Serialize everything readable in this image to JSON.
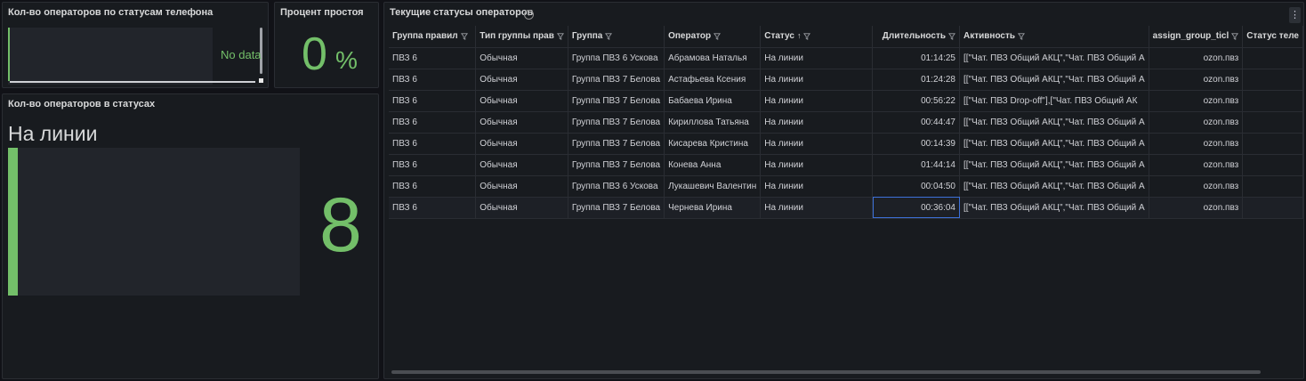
{
  "panel_phone_status": {
    "title": "Кол-во операторов по статусам телефона",
    "no_data": "No data"
  },
  "panel_idle": {
    "title": "Процент простоя",
    "value": "0",
    "unit": "%"
  },
  "panel_status_count": {
    "title": "Кол-во операторов в статусах",
    "label": "На линии",
    "value": "8",
    "bar_level": 1.0
  },
  "panel_table": {
    "title": "Текущие статусы операторов",
    "info_icon": "info-circle-icon",
    "menu_icon": "⋮",
    "columns": [
      "Группа правил",
      "Тип группы прав",
      "Группа",
      "Оператор",
      "Статус",
      "Длительность",
      "Активность",
      "assign_group_ticl",
      "Статус теле"
    ],
    "rows": [
      [
        "ПВЗ 6",
        "Обычная",
        "Группа ПВЗ 6 Ускова",
        "Абрамова Наталья",
        "На линии",
        "01:14:25",
        "[[\"Чат. ПВЗ Общий АКЦ\",\"Чат. ПВЗ Общий А",
        "ozon.пвз",
        ""
      ],
      [
        "ПВЗ 6",
        "Обычная",
        "Группа ПВЗ 7 Белова",
        "Астафьева Ксения",
        "На линии",
        "01:24:28",
        "[[\"Чат. ПВЗ Общий АКЦ\",\"Чат. ПВЗ Общий А",
        "ozon.пвз",
        ""
      ],
      [
        "ПВЗ 6",
        "Обычная",
        "Группа ПВЗ 7 Белова",
        "Бабаева Ирина",
        "На линии",
        "00:56:22",
        "[[\"Чат. ПВЗ Drop-off\"],[\"Чат. ПВЗ Общий АК",
        "ozon.пвз",
        ""
      ],
      [
        "ПВЗ 6",
        "Обычная",
        "Группа ПВЗ 7 Белова",
        "Кириллова Татьяна",
        "На линии",
        "00:44:47",
        "[[\"Чат. ПВЗ Общий АКЦ\",\"Чат. ПВЗ Общий А",
        "ozon.пвз",
        ""
      ],
      [
        "ПВЗ 6",
        "Обычная",
        "Группа ПВЗ 7 Белова",
        "Кисарева Кристина",
        "На линии",
        "00:14:39",
        "[[\"Чат. ПВЗ Общий АКЦ\",\"Чат. ПВЗ Общий А",
        "ozon.пвз",
        ""
      ],
      [
        "ПВЗ 6",
        "Обычная",
        "Группа ПВЗ 7 Белова",
        "Конева Анна",
        "На линии",
        "01:44:14",
        "[[\"Чат. ПВЗ Общий АКЦ\",\"Чат. ПВЗ Общий А",
        "ozon.пвз",
        ""
      ],
      [
        "ПВЗ 6",
        "Обычная",
        "Группа ПВЗ 6 Ускова",
        "Лукашевич Валентин",
        "На линии",
        "00:04:50",
        "[[\"Чат. ПВЗ Общий АКЦ\",\"Чат. ПВЗ Общий А",
        "ozon.пвз",
        ""
      ],
      [
        "ПВЗ 6",
        "Обычная",
        "Группа ПВЗ 7 Белова",
        "Чернева Ирина",
        "На линии",
        "00:36:04",
        "[[\"Чат. ПВЗ Общий АКЦ\",\"Чат. ПВЗ Общий А",
        "ozon.пвз",
        ""
      ]
    ]
  },
  "colors": {
    "background": "#111217",
    "panel": "#181b1f",
    "accent_green": "#73bf69",
    "text": "#ccccdc"
  }
}
